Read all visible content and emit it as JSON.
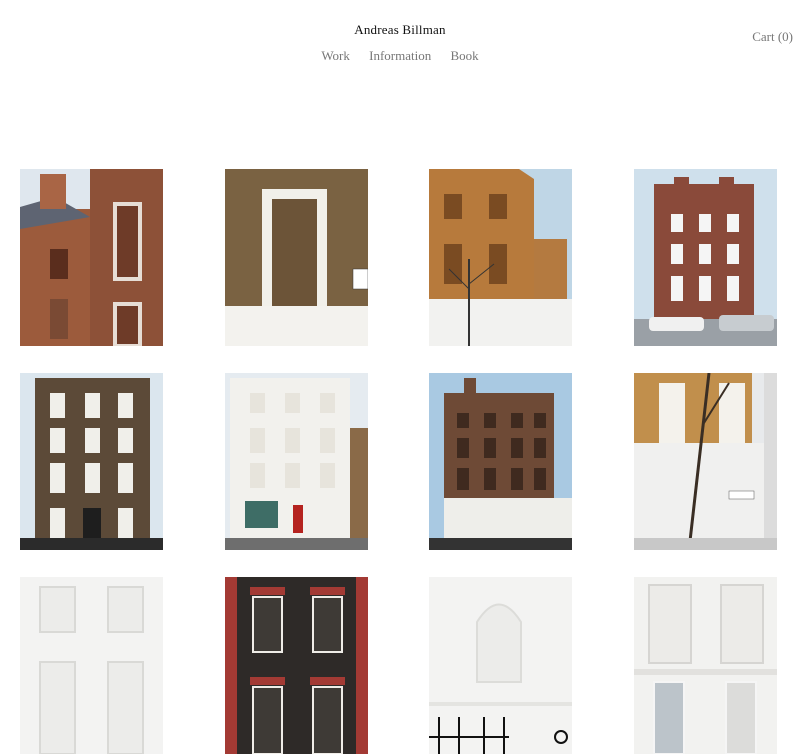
{
  "header": {
    "site_title": "Andreas Billman",
    "nav": [
      "Work",
      "Information",
      "Book"
    ],
    "cart_label": "Cart (0)"
  },
  "gallery": {
    "tiles": [
      "brick-houses-chimney",
      "bricked-window-doorway",
      "tan-brick-house-tree",
      "georgian-house-with-cars",
      "tall-brick-townhouse",
      "white-stucco-building-red-door",
      "brick-house-white-base",
      "brick-facade-bare-tree",
      "white-facade-blind-windows",
      "dark-brick-red-trim",
      "white-wall-arched-niche",
      "white-facade-panels"
    ]
  }
}
